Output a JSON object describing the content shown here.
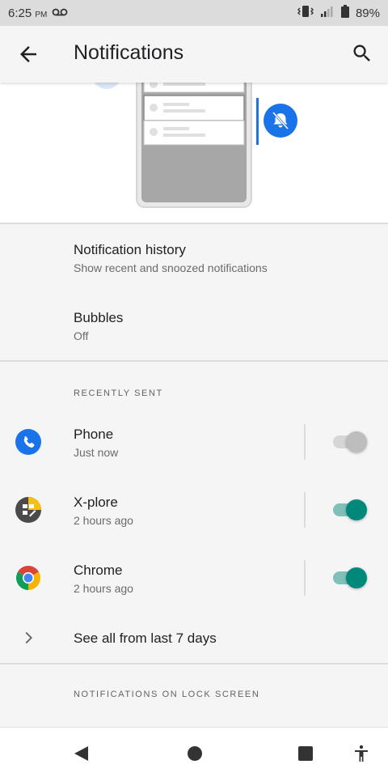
{
  "status_bar": {
    "time": "6:25",
    "ampm": "PM",
    "battery": "89%"
  },
  "app_bar": {
    "title": "Notifications"
  },
  "settings": {
    "history_title": "Notification history",
    "history_sub": "Show recent and snoozed notifications",
    "bubbles_title": "Bubbles",
    "bubbles_sub": "Off"
  },
  "recently_sent": {
    "header": "RECENTLY SENT",
    "apps": [
      {
        "name": "Phone",
        "time": "Just now",
        "enabled": false
      },
      {
        "name": "X-plore",
        "time": "2 hours ago",
        "enabled": true
      },
      {
        "name": "Chrome",
        "time": "2 hours ago",
        "enabled": true
      }
    ],
    "see_all": "See all from last 7 days"
  },
  "lock_screen": {
    "header": "NOTIFICATIONS ON LOCK SCREEN"
  },
  "colors": {
    "accent_teal": "#00897b",
    "phone_blue": "#1a73e8"
  }
}
